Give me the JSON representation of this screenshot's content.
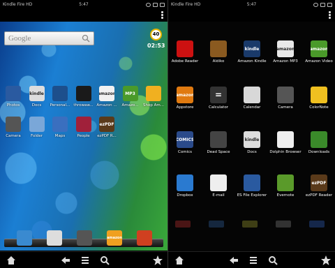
{
  "left": {
    "status": {
      "device": "Kindle Fire HD",
      "time": "5:47"
    },
    "search": {
      "logo": "Google"
    },
    "clock": {
      "badge": "40",
      "time": "02:53"
    },
    "rows": [
      [
        {
          "label": "Photos",
          "icon": "photos-icon",
          "color": "#2a5aa0"
        },
        {
          "label": "Docs",
          "icon": "kindle-docs-icon",
          "color": "#ddd",
          "text": "kindle"
        },
        {
          "label": "Personal...",
          "icon": "video-icon",
          "color": "#1d4f8c"
        },
        {
          "label": "throwaw...",
          "icon": "chrome-icon",
          "color": "#1a1a1a"
        },
        {
          "label": "Amazon ...",
          "icon": "amazon-icon",
          "color": "#f1f1f1",
          "text": "amazon"
        },
        {
          "label": "Amazo...",
          "icon": "amazon-mp3-icon",
          "color": "#4a9a2a",
          "text": "MP3"
        },
        {
          "label": "Shop Am...",
          "icon": "shop-amazon-icon",
          "color": "#f0b020"
        }
      ],
      [
        {
          "label": "Camera",
          "icon": "camera-icon",
          "color": "#555"
        },
        {
          "label": "Folder",
          "icon": "folder-icon",
          "color": "#7aa7d8"
        },
        {
          "label": "Maps",
          "icon": "maps-icon",
          "color": "#3a6fbf"
        },
        {
          "label": "People",
          "icon": "people-icon",
          "color": "#a0203a"
        },
        {
          "label": "ezPDF R...",
          "icon": "ezpdf-icon",
          "color": "#5a3a1a",
          "text": "ezPDF"
        }
      ]
    ],
    "dock": [
      {
        "icon": "gallery-icon",
        "color": "#3a8ad0"
      },
      {
        "icon": "dolphin-icon",
        "color": "#ddd"
      },
      {
        "icon": "apps-grid-icon",
        "color": "#555"
      },
      {
        "icon": "amazon-apps-icon",
        "color": "#f0a020",
        "text": "amazon"
      },
      {
        "icon": "game-icon",
        "color": "#d04020"
      }
    ]
  },
  "right": {
    "status": {
      "device": "Kindle Fire HD",
      "time": "5:47"
    },
    "rows": [
      [
        {
          "label": "Adobe Reader",
          "icon": "adobe-reader-icon",
          "color": "#cc1111"
        },
        {
          "label": "Aldiko",
          "icon": "aldiko-icon",
          "color": "#8a5a20"
        },
        {
          "label": "Amazon Kindle",
          "icon": "kindle-icon",
          "color": "#1a3a6a",
          "text": "kindle"
        },
        {
          "label": "Amazon MP3",
          "icon": "amazon-mp3-icon",
          "color": "#e8e8e8",
          "text": "amazon"
        },
        {
          "label": "Amazon Video",
          "icon": "amazon-video-icon",
          "color": "#4a9a2a",
          "text": "amazon"
        }
      ],
      [
        {
          "label": "Appstore",
          "icon": "appstore-icon",
          "color": "#e07a10",
          "text": "amazon"
        },
        {
          "label": "Calculator",
          "icon": "calculator-icon",
          "color": "#333",
          "text": "="
        },
        {
          "label": "Calendar",
          "icon": "calendar-icon",
          "color": "#d8d8d8"
        },
        {
          "label": "Camera",
          "icon": "camera-icon",
          "color": "#555"
        },
        {
          "label": "ColorNote",
          "icon": "colornote-icon",
          "color": "#f0c020"
        }
      ],
      [
        {
          "label": "Comics",
          "icon": "comics-icon",
          "color": "#2a4a8a",
          "text": "COMICS"
        },
        {
          "label": "Dead Space",
          "icon": "dead-space-icon",
          "color": "#444"
        },
        {
          "label": "Docs",
          "icon": "kindle-docs-icon",
          "color": "#ddd",
          "text": "kindle"
        },
        {
          "label": "Dolphin Browser",
          "icon": "dolphin-browser-icon",
          "color": "#eee"
        },
        {
          "label": "Downloads",
          "icon": "downloads-icon",
          "color": "#3a8a2a"
        }
      ],
      [
        {
          "label": "Dropbox",
          "icon": "dropbox-icon",
          "color": "#2a7ad0"
        },
        {
          "label": "E-mail",
          "icon": "email-icon",
          "color": "#eee"
        },
        {
          "label": "ES File Explorer",
          "icon": "es-file-explorer-icon",
          "color": "#2a5aa0"
        },
        {
          "label": "Evernote",
          "icon": "evernote-icon",
          "color": "#5a9a2a"
        },
        {
          "label": "ezPDF Reader",
          "icon": "ezpdf-icon",
          "color": "#5a3a1a",
          "text": "ezPDF"
        }
      ]
    ]
  },
  "nav": [
    "home-icon",
    "back-arrow-icon",
    "menu-list-icon",
    "search-icon",
    "favorites-star-icon"
  ]
}
